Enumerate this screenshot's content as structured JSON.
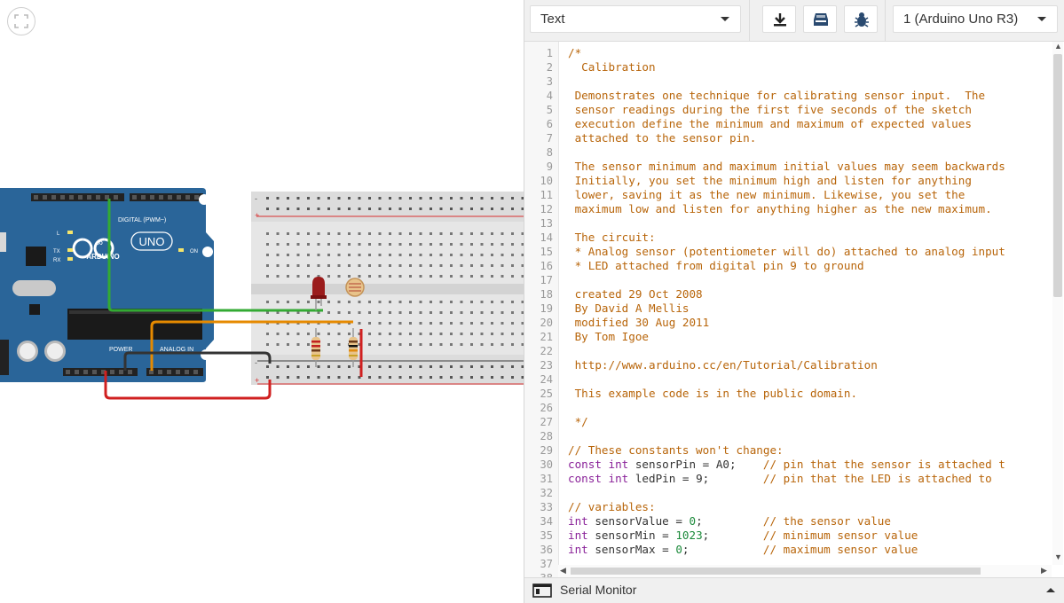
{
  "canvas": {
    "fit_icon": "fit-view-icon",
    "arduino": {
      "logo": "ARDUINO",
      "model": "UNO",
      "digital_label": "DIGITAL (PWM~)",
      "power_label": "POWER",
      "analog_label": "ANALOG IN",
      "on_label": "ON",
      "tx": "TX",
      "rx": "RX",
      "l": "L"
    },
    "colors": {
      "board": "#2a6599",
      "wire_green": "#33aa33",
      "wire_orange": "#e68a00",
      "wire_red": "#d02020",
      "wire_black": "#333333",
      "led": "#9b1c1c"
    }
  },
  "toolbar": {
    "mode_select": "Text",
    "download_icon": "download-icon",
    "library_icon": "library-icon",
    "debug_icon": "bug-icon",
    "board_select": "1 (Arduino Uno R3)"
  },
  "editor": {
    "lines": [
      [
        [
          "c",
          "/*"
        ]
      ],
      [
        [
          "c",
          "  Calibration"
        ]
      ],
      [],
      [
        [
          "c",
          " Demonstrates one technique for calibrating sensor input.  The"
        ]
      ],
      [
        [
          "c",
          " sensor readings during the first five seconds of the sketch"
        ]
      ],
      [
        [
          "c",
          " execution define the minimum and maximum of expected values"
        ]
      ],
      [
        [
          "c",
          " attached to the sensor pin."
        ]
      ],
      [],
      [
        [
          "c",
          " The sensor minimum and maximum initial values may seem backwards"
        ]
      ],
      [
        [
          "c",
          " Initially, you set the minimum high and listen for anything"
        ]
      ],
      [
        [
          "c",
          " lower, saving it as the new minimum. Likewise, you set the"
        ]
      ],
      [
        [
          "c",
          " maximum low and listen for anything higher as the new maximum."
        ]
      ],
      [],
      [
        [
          "c",
          " The circuit:"
        ]
      ],
      [
        [
          "c",
          " * Analog sensor (potentiometer will do) attached to analog input"
        ]
      ],
      [
        [
          "c",
          " * LED attached from digital pin 9 to ground"
        ]
      ],
      [],
      [
        [
          "c",
          " created 29 Oct 2008"
        ]
      ],
      [
        [
          "c",
          " By David A Mellis"
        ]
      ],
      [
        [
          "c",
          " modified 30 Aug 2011"
        ]
      ],
      [
        [
          "c",
          " By Tom Igoe"
        ]
      ],
      [],
      [
        [
          "c",
          " http://www.arduino.cc/en/Tutorial/Calibration"
        ]
      ],
      [],
      [
        [
          "c",
          " This example code is in the public domain."
        ]
      ],
      [],
      [
        [
          "c",
          " */"
        ]
      ],
      [],
      [
        [
          "c",
          "// These constants won't change:"
        ]
      ],
      [
        [
          "kw",
          "const int"
        ],
        [
          "t",
          " sensorPin = A0;    "
        ],
        [
          "c",
          "// pin that the sensor is attached t"
        ]
      ],
      [
        [
          "kw",
          "const int"
        ],
        [
          "t",
          " ledPin = 9;        "
        ],
        [
          "c",
          "// pin that the LED is attached to"
        ]
      ],
      [],
      [
        [
          "c",
          "// variables:"
        ]
      ],
      [
        [
          "kw",
          "int"
        ],
        [
          "t",
          " sensorValue = "
        ],
        [
          "nm",
          "0"
        ],
        [
          "t",
          ";         "
        ],
        [
          "c",
          "// the sensor value"
        ]
      ],
      [
        [
          "kw",
          "int"
        ],
        [
          "t",
          " sensorMin = "
        ],
        [
          "nm",
          "1023"
        ],
        [
          "t",
          ";        "
        ],
        [
          "c",
          "// minimum sensor value"
        ]
      ],
      [
        [
          "kw",
          "int"
        ],
        [
          "t",
          " sensorMax = "
        ],
        [
          "nm",
          "0"
        ],
        [
          "t",
          ";           "
        ],
        [
          "c",
          "// maximum sensor value"
        ]
      ],
      [],
      []
    ]
  },
  "serial_monitor": {
    "label": "Serial Monitor",
    "icon": "serial-monitor-icon"
  }
}
